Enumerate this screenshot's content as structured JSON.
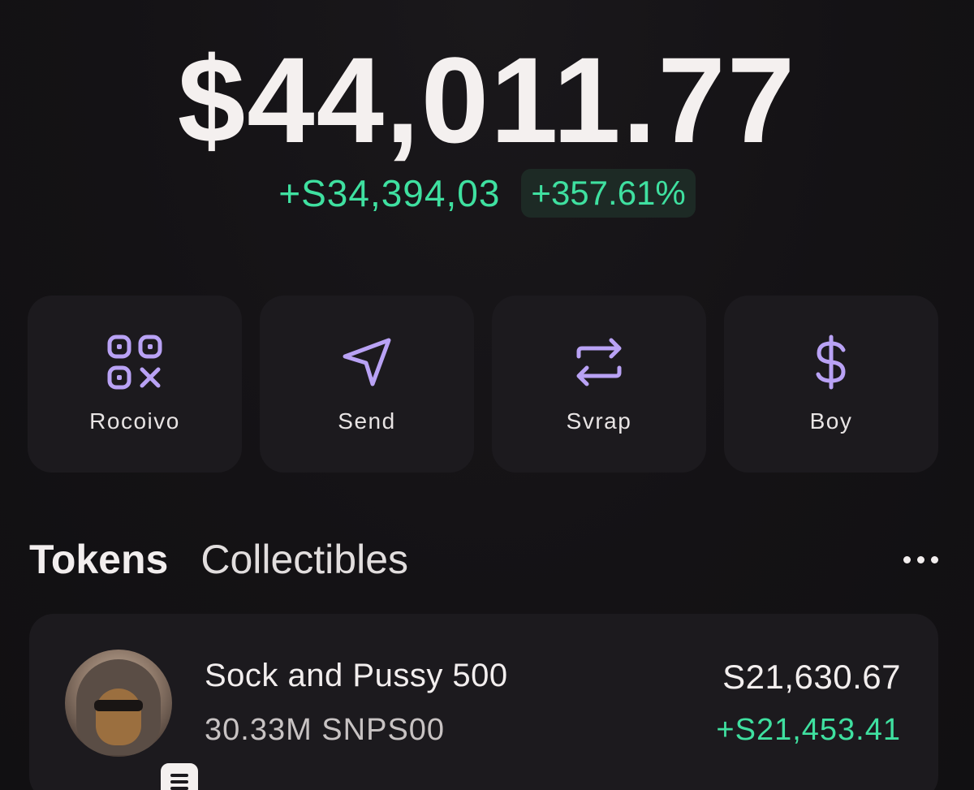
{
  "balance": {
    "total": "$44,011.77",
    "change_abs": "+S34,394,03",
    "change_pct": "+357.61%"
  },
  "actions": [
    {
      "label": "Rocoivo",
      "icon": "qr-code-icon"
    },
    {
      "label": "Send",
      "icon": "send-arrow-icon"
    },
    {
      "label": "Svrap",
      "icon": "swap-arrows-icon"
    },
    {
      "label": "Boy",
      "icon": "dollar-icon"
    }
  ],
  "tabs": {
    "tokens": "Tokens",
    "collectibles": "Collectibles",
    "more_icon": "more-dots-icon"
  },
  "tokens": [
    {
      "name": "Sock and Pussy 500",
      "amount": "30.33M SNPS00",
      "value": "S21,630.67",
      "change": "+S21,453.41",
      "badge_icon": "chain-badge-icon"
    }
  ],
  "colors": {
    "accent_purple": "#b9a2f5",
    "positive_green": "#3fe0a0",
    "card": "#1c1a1e",
    "background": "#121013"
  }
}
